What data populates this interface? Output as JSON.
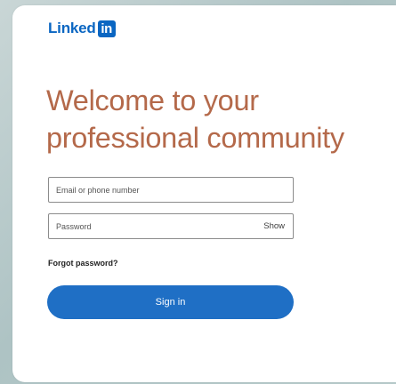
{
  "brand": {
    "logo_text": "Linked",
    "logo_badge": "in",
    "text_color": "#0a66c2",
    "badge_color": "#0a66c2"
  },
  "headline": {
    "text": "Welcome to your professional community",
    "color": "#b4694a"
  },
  "form": {
    "email_placeholder": "Email or phone number",
    "email_value": "",
    "password_placeholder": "Password",
    "password_value": "",
    "show_label": "Show",
    "forgot_label": "Forgot password?",
    "signin_label": "Sign in",
    "signin_color": "#1f6fc5"
  }
}
